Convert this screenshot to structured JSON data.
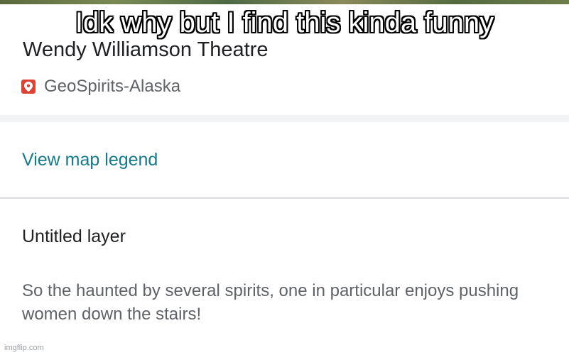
{
  "meme": {
    "caption": "Idk why but I find this kinda funny",
    "watermark": "imgflip.com"
  },
  "place": {
    "title": "Wendy Williamson Theatre",
    "source_map": "GeoSpirits-Alaska",
    "source_icon": "map-pin-icon",
    "source_icon_color": "#db4437"
  },
  "legend": {
    "link_label": "View map legend",
    "link_color": "#137b8a"
  },
  "layer": {
    "name": "Untitled layer",
    "description": "So the haunted by several spirits, one in particular enjoys pushing women down the stairs!"
  }
}
